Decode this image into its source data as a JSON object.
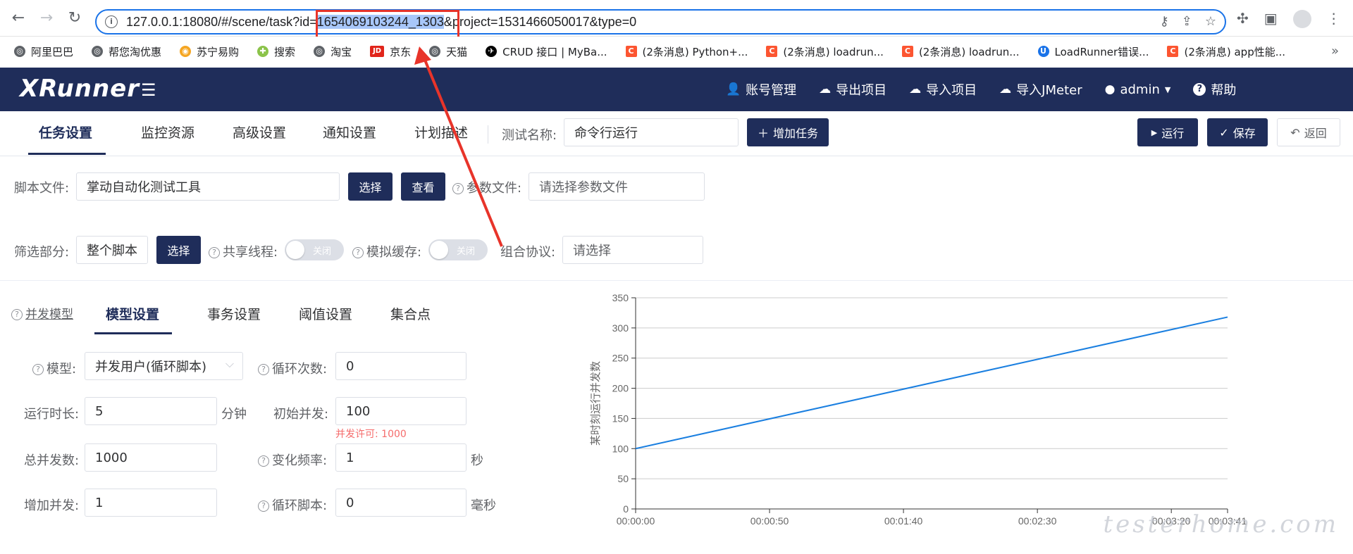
{
  "browser": {
    "url_prefix": "127.0.0.1:18080/#/scene/task?id=",
    "url_highlight": "1654069103244_1303",
    "url_suffix": "&project=1531466050017&type=0",
    "bookmarks": [
      {
        "label": "阿里巴巴",
        "icon": "globe-icon",
        "color": "#5f6368"
      },
      {
        "label": "帮您淘优惠",
        "icon": "globe-icon",
        "color": "#5f6368"
      },
      {
        "label": "苏宁易购",
        "icon": "suning-icon",
        "color": "#f5a623"
      },
      {
        "label": "搜索",
        "icon": "search-plus-icon",
        "color": "#8bc34a"
      },
      {
        "label": "淘宝",
        "icon": "globe-icon",
        "color": "#5f6368"
      },
      {
        "label": "京东",
        "icon": "jd-icon",
        "color": "#e1251b"
      },
      {
        "label": "天猫",
        "icon": "globe-icon",
        "color": "#5f6368"
      },
      {
        "label": "CRUD 接口 | MyBa...",
        "icon": "bird-icon",
        "color": "#000000"
      },
      {
        "label": "(2条消息) Python+...",
        "icon": "csdn-icon",
        "color": "#fc5531"
      },
      {
        "label": "(2条消息) loadrun...",
        "icon": "csdn-icon",
        "color": "#fc5531"
      },
      {
        "label": "(2条消息) loadrun...",
        "icon": "csdn-icon",
        "color": "#fc5531"
      },
      {
        "label": "LoadRunner错误...",
        "icon": "u-icon",
        "color": "#1a73e8"
      },
      {
        "label": "(2条消息) app性能...",
        "icon": "csdn-icon",
        "color": "#fc5531"
      }
    ]
  },
  "header": {
    "logo": "XRunner",
    "menu": [
      {
        "label": "账号管理",
        "icon": "user-icon"
      },
      {
        "label": "导出项目",
        "icon": "cloud-download-icon"
      },
      {
        "label": "导入项目",
        "icon": "cloud-upload-icon"
      },
      {
        "label": "导入JMeter",
        "icon": "cloud-upload-icon"
      },
      {
        "label": "admin",
        "icon": "avatar-icon"
      },
      {
        "label": "帮助",
        "icon": "help-icon"
      }
    ]
  },
  "tabs": [
    "任务设置",
    "监控资源",
    "高级设置",
    "通知设置",
    "计划描述"
  ],
  "test_name": {
    "label": "测试名称:",
    "value": "命令行运行"
  },
  "buttons": {
    "add_task": "增加任务",
    "run": "运行",
    "save": "保存",
    "back": "返回",
    "choose": "选择",
    "view": "查看",
    "choose2": "选择"
  },
  "script": {
    "label": "脚本文件:",
    "value": "掌动自动化测试工具"
  },
  "param": {
    "label": "参数文件:",
    "placeholder": "请选择参数文件"
  },
  "filter": {
    "label": "筛选部分:",
    "value": "整个脚本"
  },
  "shared_thread": {
    "label": "共享线程:",
    "state": "关闭"
  },
  "sim_cache": {
    "label": "模拟缓存:",
    "state": "关闭"
  },
  "combo": {
    "label": "组合协议:",
    "placeholder": "请选择"
  },
  "sub_tabs": {
    "concurrency_model": "并发模型",
    "items": [
      "模型设置",
      "事务设置",
      "阈值设置",
      "集合点"
    ]
  },
  "model": {
    "model_label": "模型:",
    "model_value": "并发用户(循环脚本)",
    "loop_label": "循环次数:",
    "loop_value": "0",
    "duration_label": "运行时长:",
    "duration_value": "5",
    "duration_unit": "分钟",
    "initial_label": "初始并发:",
    "initial_value": "100",
    "license_note": "并发许可: 1000",
    "total_label": "总并发数:",
    "total_value": "1000",
    "freq_label": "变化频率:",
    "freq_value": "1",
    "freq_unit": "秒",
    "inc_label": "增加并发:",
    "inc_value": "1",
    "loop_script_label": "循环脚本:",
    "loop_script_value": "0",
    "loop_script_unit": "毫秒"
  },
  "watermark": "testerhome.com",
  "chart_data": {
    "type": "line",
    "ylabel": "某时刻运行并发数",
    "xlabel": "",
    "x_ticks": [
      "00:00:00",
      "00:00:50",
      "00:01:40",
      "00:02:30",
      "00:03:20",
      "00:03:41"
    ],
    "y_ticks": [
      0,
      50,
      100,
      150,
      200,
      250,
      300,
      350
    ],
    "ylim": [
      0,
      350
    ],
    "xlim_seconds": [
      0,
      221
    ],
    "series": [
      {
        "x_seconds": [
          0,
          221
        ],
        "values": [
          100,
          318
        ],
        "color": "#1a7fe0"
      }
    ],
    "grid": true
  }
}
